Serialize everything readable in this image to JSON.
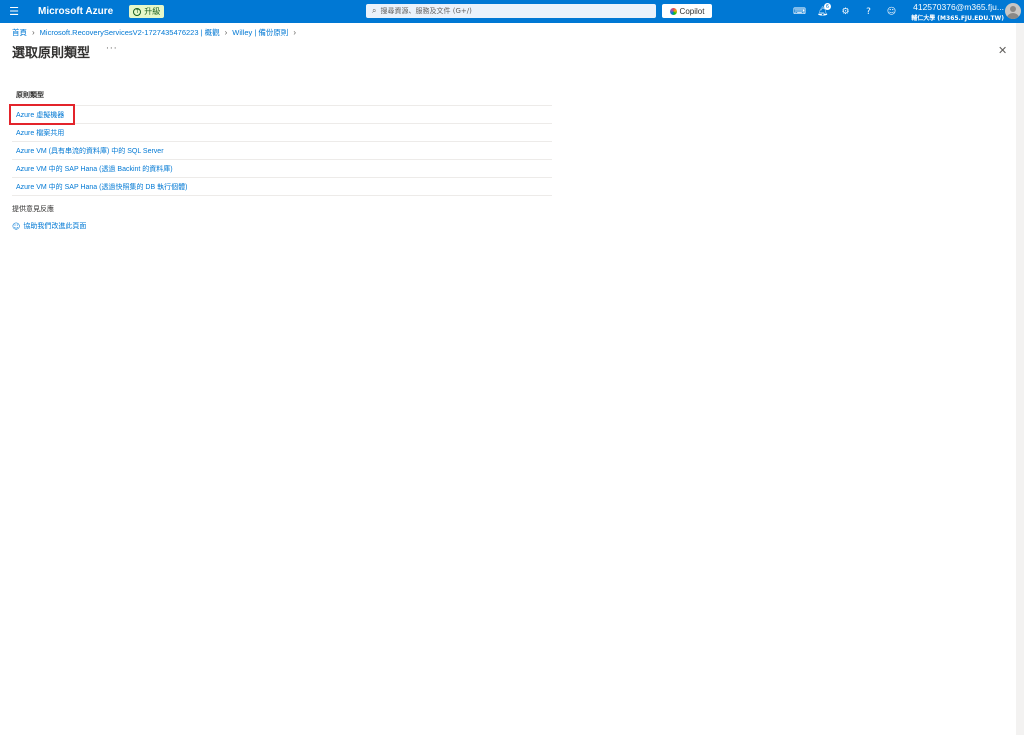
{
  "topbar": {
    "menu_icon": "hamburger-icon",
    "brand": "Microsoft Azure",
    "upgrade_label": "升級",
    "search_placeholder": "搜尋資源、服務及文件 (G+/)",
    "copilot_label": "Copilot",
    "notification_count": "6",
    "account_name": "412570376@m365.fju...",
    "account_org": "輔仁大學 (M365.FJU.EDU.TW)",
    "icons": [
      "cloud-shell-icon",
      "notifications-icon",
      "settings-icon",
      "help-icon",
      "feedback-icon"
    ]
  },
  "breadcrumb": {
    "items": [
      "首頁",
      "Microsoft.RecoveryServicesV2-1727435476223 | 概觀",
      "Willey | 備份原則"
    ]
  },
  "page": {
    "title": "選取原則類型",
    "more": "···",
    "close": "✕"
  },
  "policy_types": {
    "label": "原則類型",
    "items": [
      "Azure 虛擬機器",
      "Azure 檔案共用",
      "Azure VM (具有串流的資料庫) 中的 SQL Server",
      "Azure VM 中的 SAP Hana (透過 Backint 的資料庫)",
      "Azure VM 中的 SAP Hana (透過快照集的 DB 執行個體)"
    ],
    "highlighted_index": 0
  },
  "feedback": {
    "title": "提供意見反應",
    "link": "協助我們改進此頁面"
  },
  "colors": {
    "topbar": "#0078d4",
    "link": "#0078d4",
    "highlight": "#e3242b"
  }
}
